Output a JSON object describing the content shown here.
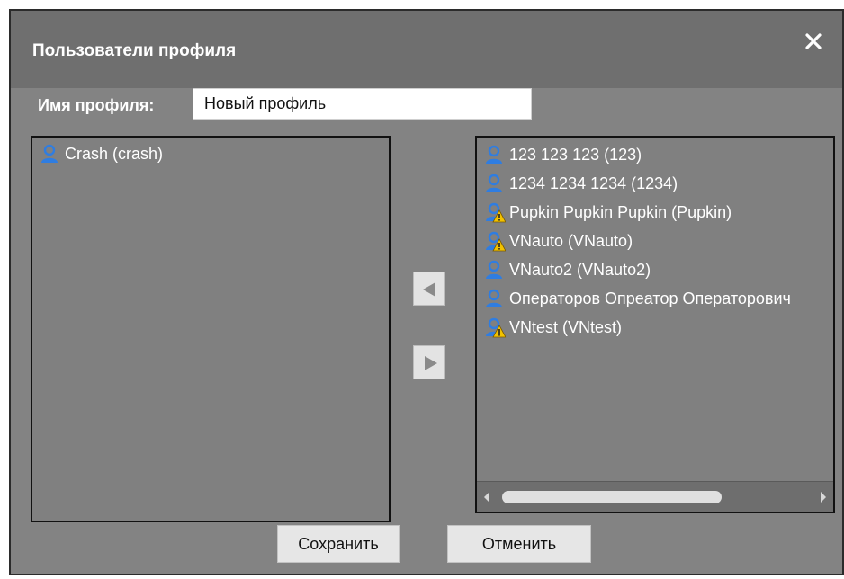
{
  "dialog": {
    "title": "Пользователи профиля",
    "close_icon": "close-icon"
  },
  "profile": {
    "name_label": "Имя профиля:",
    "name_value": "Новый профиль"
  },
  "left_list": {
    "items": [
      {
        "label": "Crash   (crash)",
        "icon": "user-icon",
        "warning": false
      }
    ]
  },
  "right_list": {
    "items": [
      {
        "label": "123 123 123 (123)",
        "icon": "user-icon",
        "warning": false
      },
      {
        "label": "1234 1234 1234 (1234)",
        "icon": "user-icon",
        "warning": false
      },
      {
        "label": "Pupkin Pupkin Pupkin (Pupkin)",
        "icon": "user-warning-icon",
        "warning": true
      },
      {
        "label": "VNauto   (VNauto)",
        "icon": "user-warning-icon",
        "warning": true
      },
      {
        "label": "VNauto2   (VNauto2)",
        "icon": "user-icon",
        "warning": false
      },
      {
        "label": "Операторов Опреатор Операторович",
        "icon": "user-icon",
        "warning": false
      },
      {
        "label": "VNtest   (VNtest)",
        "icon": "user-warning-icon",
        "warning": true
      }
    ]
  },
  "controls": {
    "move_left_icon": "arrow-left-icon",
    "move_right_icon": "arrow-right-icon",
    "save_label": "Сохранить",
    "cancel_label": "Отменить"
  },
  "colors": {
    "user_icon": "#2f7de1",
    "warning_icon": "#f2c200"
  }
}
